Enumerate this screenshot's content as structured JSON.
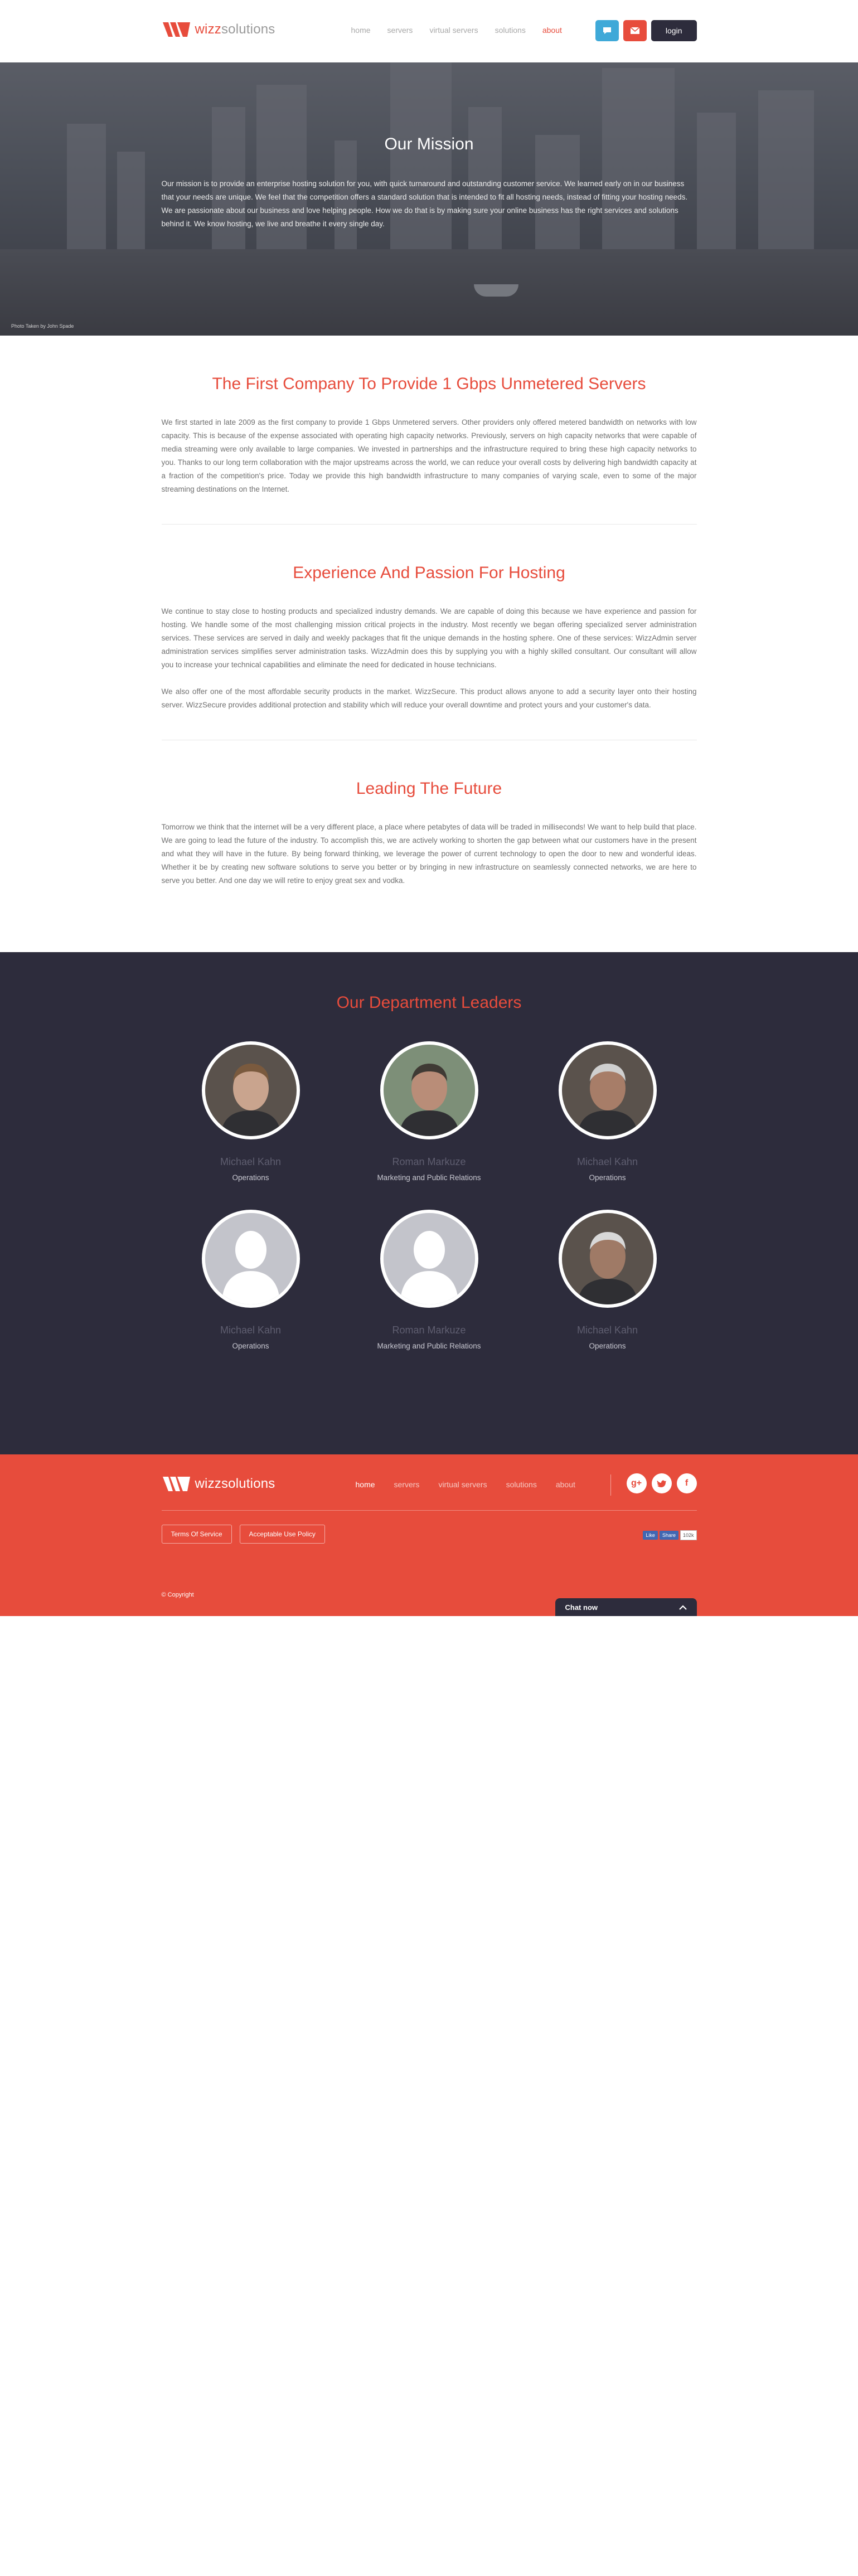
{
  "header": {
    "logo_text_a": "wizz",
    "logo_text_b": "solutions",
    "nav": [
      "home",
      "servers",
      "virtual servers",
      "solutions",
      "about"
    ],
    "active_nav": "about",
    "chat_icon": "chat-bubble-icon",
    "mail_icon": "mail-icon",
    "login_label": "login"
  },
  "hero": {
    "title": "Our Mission",
    "text": "Our mission is to provide an enterprise hosting solution for you, with quick turnaround and outstanding customer service. We learned early on in our business that your needs are unique. We feel that the competition offers a standard solution that is intended to fit all hosting needs, instead of fitting your hosting needs. We are passionate about our business and love helping people. How we do that is by making sure your online business has the right services and solutions behind it. We know hosting, we live and breathe it every single day.",
    "photo_credit": "Photo Taken by John Spade"
  },
  "sections": [
    {
      "title": "The First Company To Provide 1 Gbps Unmetered Servers",
      "paragraphs": [
        "We first started in late 2009 as the first company to provide 1 Gbps Unmetered servers. Other providers only offered metered bandwidth on networks with low capacity. This is because of the expense associated with operating high capacity networks. Previously, servers on high capacity networks that were capable of media streaming were only available to large companies. We invested in partnerships and the infrastructure required to bring these high capacity networks to you. Thanks to our long term collaboration with the major upstreams across the world, we can reduce your overall costs by delivering high bandwidth capacity at a fraction of the competition's price. Today we provide this high bandwidth infrastructure to many companies of varying scale, even to some of the major streaming destinations on the Internet."
      ]
    },
    {
      "title": "Experience And Passion For Hosting",
      "paragraphs": [
        "We continue to stay close to hosting products and specialized industry demands. We are capable of doing this because we have experience and passion for hosting. We handle some of the most challenging mission critical projects in the industry. Most recently we began offering specialized server administration services. These services are served in daily and weekly packages that fit the unique demands in the hosting sphere. One of these services: WizzAdmin server administration services simplifies server administration tasks. WizzAdmin does this by supplying you with a highly skilled consultant. Our consultant will allow you to increase your technical capabilities and eliminate the need for dedicated in house technicians.",
        "We also offer one of the most affordable security products in the market. WizzSecure. This product allows anyone to add a security layer onto their hosting server. WizzSecure provides additional protection and stability which will reduce your overall downtime and protect yours and your customer's data."
      ]
    },
    {
      "title": "Leading The Future",
      "paragraphs": [
        "Tomorrow we think that the internet will be a very different place, a place where petabytes of data will be traded in milliseconds! We want to help build that place. We are going to lead the future of the industry. To accomplish this, we are actively working to shorten the gap between what our customers have in the present and what they will have in the future. By being forward thinking, we leverage the power of current technology to open the door to new and wonderful ideas. Whether it be by creating new software solutions to serve you better or by bringing in new infrastructure on seamlessly connected networks, we are here to serve you better. And one day we will retire to enjoy great sex and vodka."
      ]
    }
  ],
  "leaders": {
    "title": "Our Department Leaders",
    "people": [
      {
        "name": "Michael Kahn",
        "role": "Operations",
        "photo": "photo"
      },
      {
        "name": "Roman Markuze",
        "role": "Marketing and Public Relations",
        "photo": "photo"
      },
      {
        "name": "Michael Kahn",
        "role": "Operations",
        "photo": "photo"
      },
      {
        "name": "Michael Kahn",
        "role": "Operations",
        "photo": "placeholder"
      },
      {
        "name": "Roman Markuze",
        "role": "Marketing and Public Relations",
        "photo": "placeholder"
      },
      {
        "name": "Michael Kahn",
        "role": "Operations",
        "photo": "photo"
      }
    ]
  },
  "footer": {
    "logo_text": "wizzsolutions",
    "nav": [
      "home",
      "servers",
      "virtual servers",
      "solutions",
      "about"
    ],
    "social": [
      "g+",
      "twitter-icon",
      "f"
    ],
    "links": [
      "Terms Of Service",
      "Acceptable Use Policy"
    ],
    "fb_like": "Like",
    "fb_share": "Share",
    "fb_count": "102k",
    "copyright": "© Copyright",
    "chat_label": "Chat now"
  },
  "colors": {
    "accent": "#e74c3c",
    "dark": "#2d2c3c",
    "blue": "#3fa9d8"
  }
}
